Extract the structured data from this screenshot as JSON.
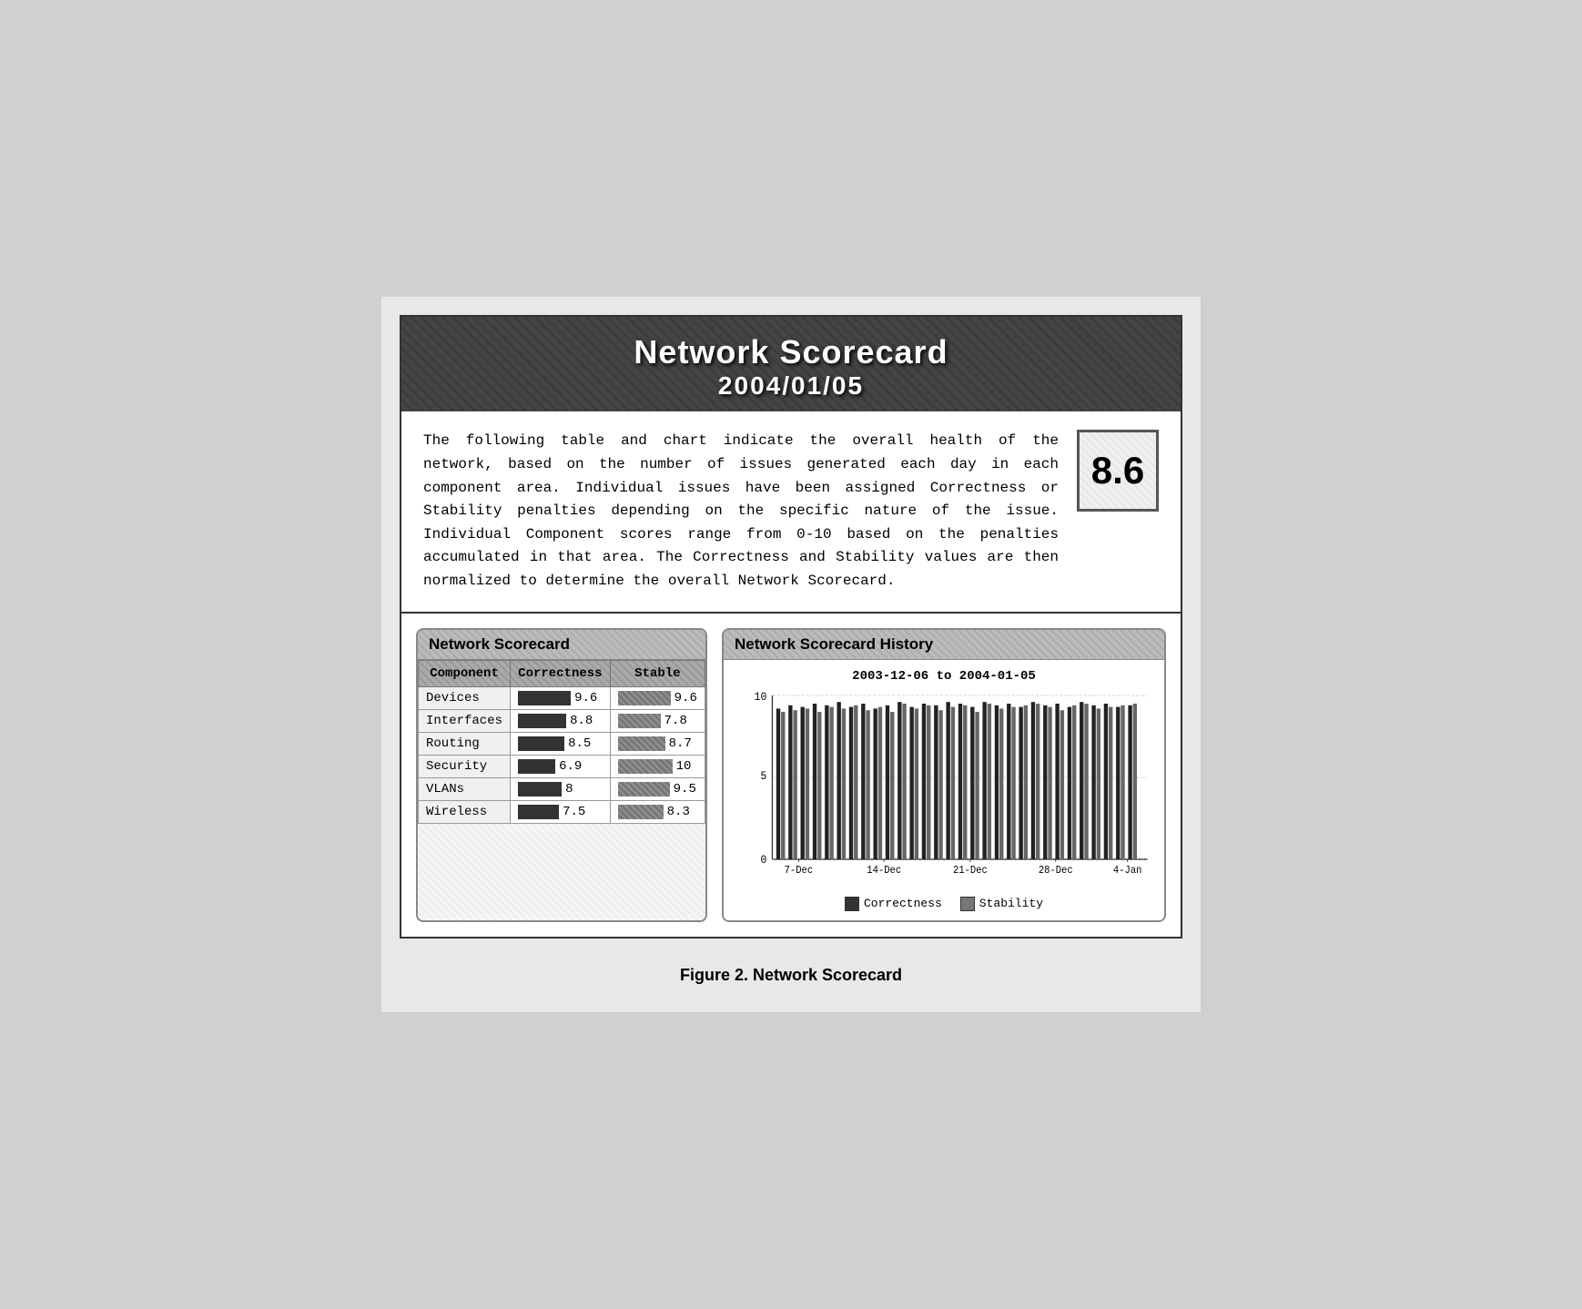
{
  "header": {
    "title": "Network Scorecard",
    "date": "2004/01/05"
  },
  "description": {
    "text": "The following table and chart indicate the overall health of the network, based on the number of issues generated each day in each component area. Individual issues have been assigned Correctness or Stability penalties depending on the specific nature of the issue. Individual Component scores range from 0-10 based on the penalties accumulated in that area. The Correctness and Stability values are then normalized to determine the overall Network Scorecard.",
    "overall_score": "8.6"
  },
  "scorecard_table": {
    "panel_title": "Network Scorecard",
    "columns": [
      "Component",
      "Correctness",
      "Stable"
    ],
    "rows": [
      {
        "component": "Devices",
        "correctness": 9.6,
        "stability": 9.6
      },
      {
        "component": "Interfaces",
        "correctness": 8.8,
        "stability": 7.8
      },
      {
        "component": "Routing",
        "correctness": 8.5,
        "stability": 8.7
      },
      {
        "component": "Security",
        "correctness": 6.9,
        "stability": 10
      },
      {
        "component": "VLANs",
        "correctness": 8,
        "stability": 9.5
      },
      {
        "component": "Wireless",
        "correctness": 7.5,
        "stability": 8.3
      }
    ]
  },
  "history_chart": {
    "panel_title": "Network Scorecard History",
    "chart_title": "2003-12-06 to 2004-01-05",
    "x_labels": [
      "7-Dec",
      "14-Dec",
      "21-Dec",
      "28-Dec",
      "4-Jan"
    ],
    "y_labels": [
      "0",
      "5",
      "10"
    ],
    "legend": {
      "correctness_label": "Correctness",
      "stability_label": "Stability"
    }
  },
  "figure_caption": "Figure 2. Network Scorecard"
}
